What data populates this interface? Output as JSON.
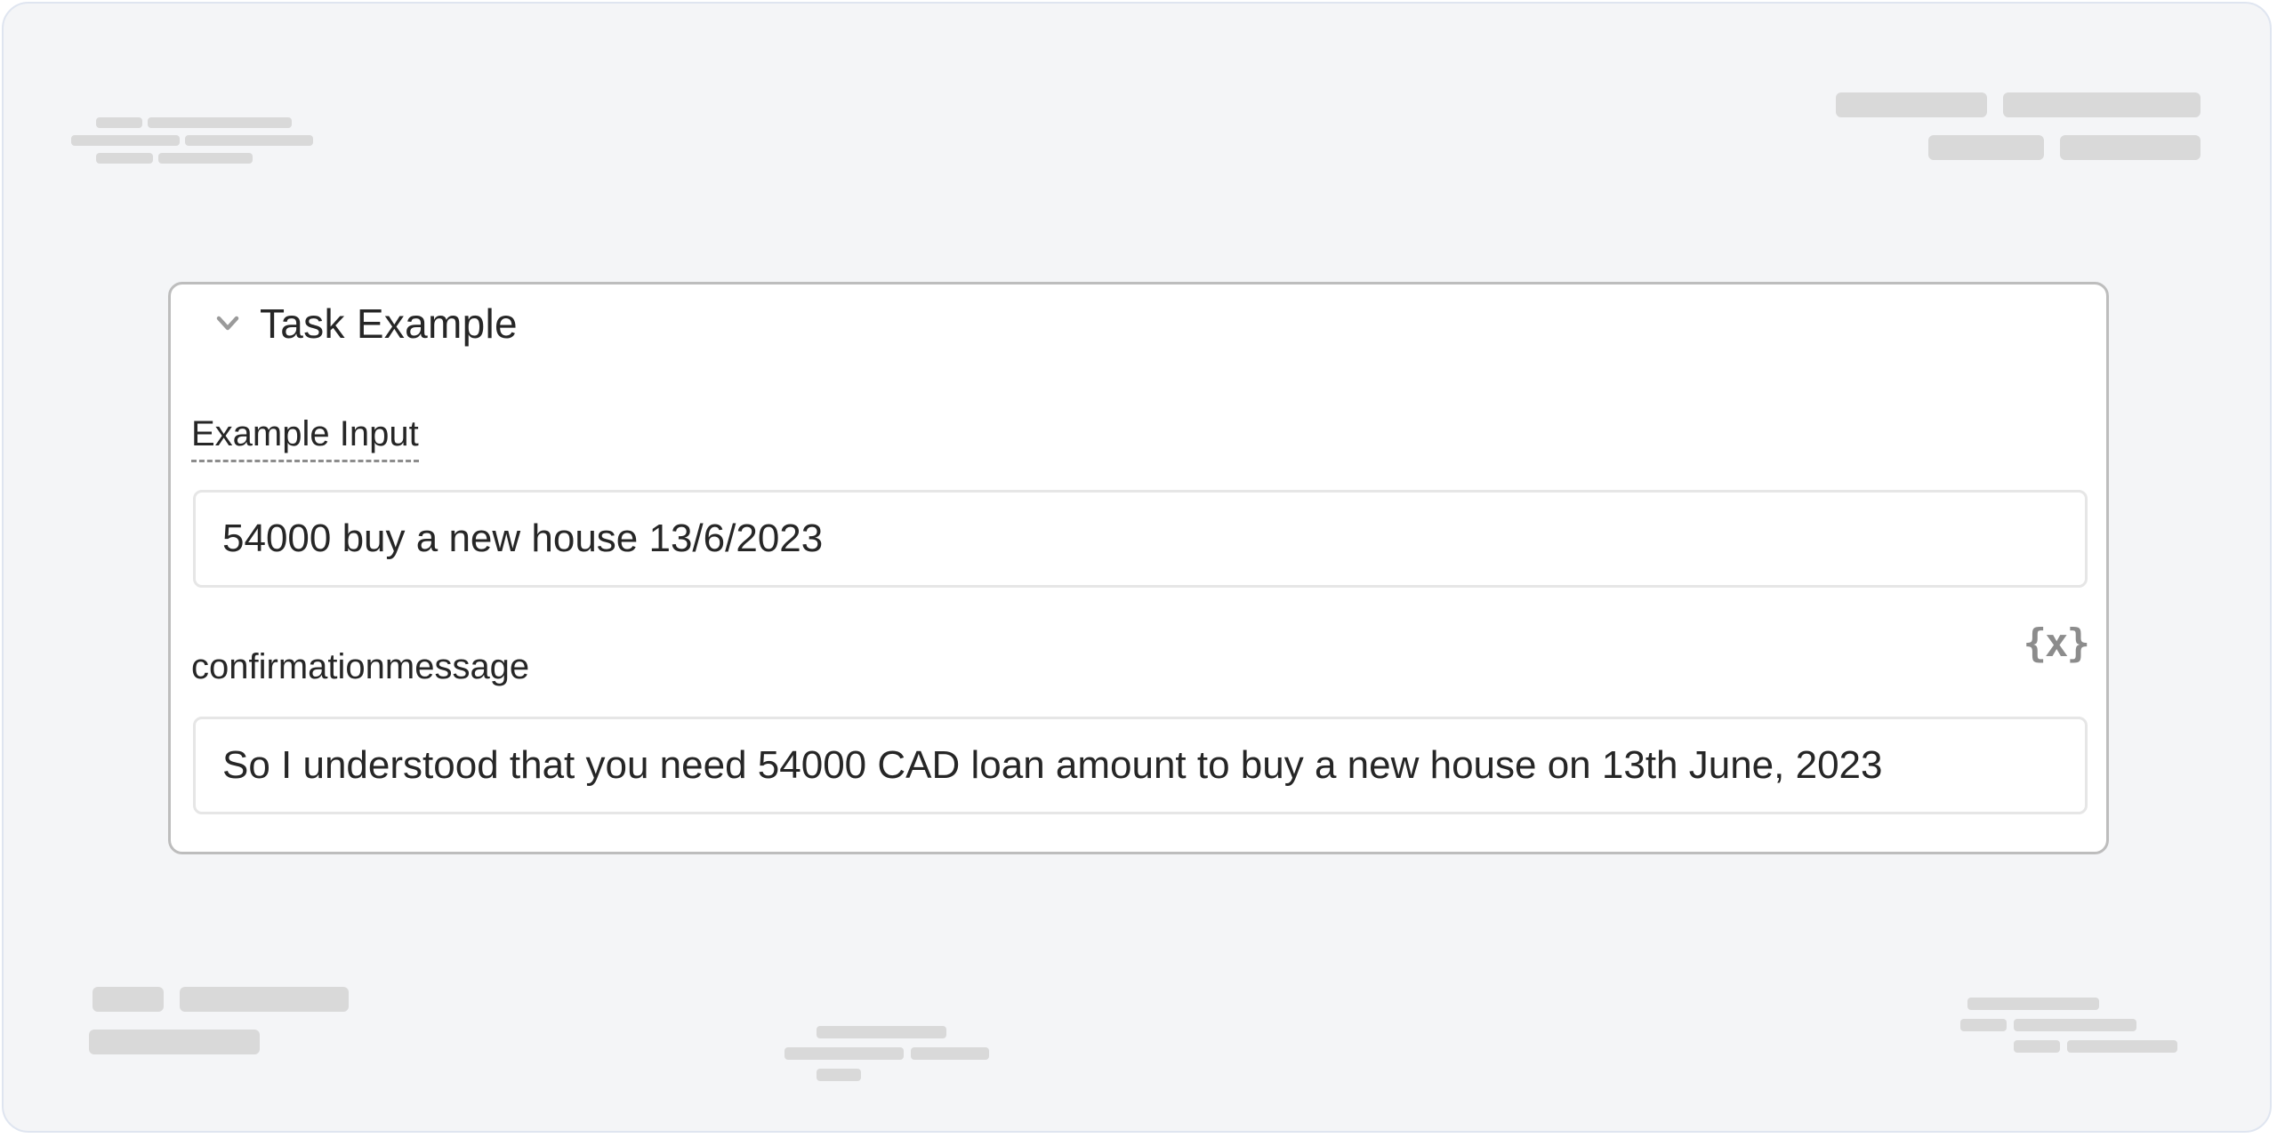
{
  "task_example": {
    "title": "Task Example",
    "collapse_icon": "chevron-down-icon",
    "example_input": {
      "label": "Example Input",
      "value": "54000 buy a new house 13/6/2023"
    },
    "confirmation": {
      "label": "confirmationmessage",
      "value": "So I understood that you need 54000 CAD loan amount to buy a new house on 13th June, 2023",
      "variable_icon": "variable-icon",
      "variable_icon_text": "{x}"
    }
  },
  "colors": {
    "background": "#f4f5f7",
    "panel_border": "#bdbdbd",
    "field_border": "#e6e6e6",
    "text": "#262626",
    "muted_icon": "#8c8c8c",
    "placeholder": "#d9d9d9"
  }
}
